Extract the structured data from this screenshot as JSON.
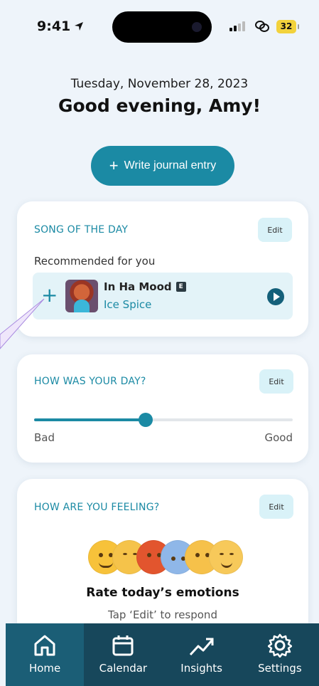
{
  "status_bar": {
    "time": "9:41",
    "battery": "32",
    "icons": [
      "location-arrow-icon",
      "signal-icon",
      "link-icon",
      "battery-icon"
    ]
  },
  "header": {
    "date": "Tuesday, November 28, 2023",
    "greeting": "Good evening, Amy!"
  },
  "write_button": {
    "label": "Write journal entry",
    "icon": "plus-icon"
  },
  "song_card": {
    "title": "SONG OF THE DAY",
    "edit_label": "Edit",
    "recommended_label": "Recommended for you",
    "song": {
      "title": "In Ha Mood",
      "explicit_badge": "E",
      "artist": "Ice Spice"
    }
  },
  "day_card": {
    "title": "HOW WAS YOUR DAY?",
    "edit_label": "Edit",
    "slider_value": 0.43,
    "min_label": "Bad",
    "max_label": "Good"
  },
  "feel_card": {
    "title": "HOW ARE YOU FEELING?",
    "edit_label": "Edit",
    "emojis": [
      "grinning-emoji-icon",
      "tired-emoji-icon",
      "angry-emoji-icon",
      "exploding-head-emoji-icon",
      "party-emoji-icon",
      "relieved-emoji-icon"
    ],
    "rate_title": "Rate today’s emotions",
    "hint": "Tap ‘Edit’ to respond"
  },
  "tabs": [
    {
      "label": "Home",
      "icon": "home-icon",
      "active": true
    },
    {
      "label": "Calendar",
      "icon": "calendar-icon",
      "active": false
    },
    {
      "label": "Insights",
      "icon": "trend-up-icon",
      "active": false
    },
    {
      "label": "Settings",
      "icon": "gear-icon",
      "active": false
    }
  ],
  "colors": {
    "accent": "#1b8aa4",
    "tab_bar": "#17475b",
    "background": "#eef4fa"
  }
}
